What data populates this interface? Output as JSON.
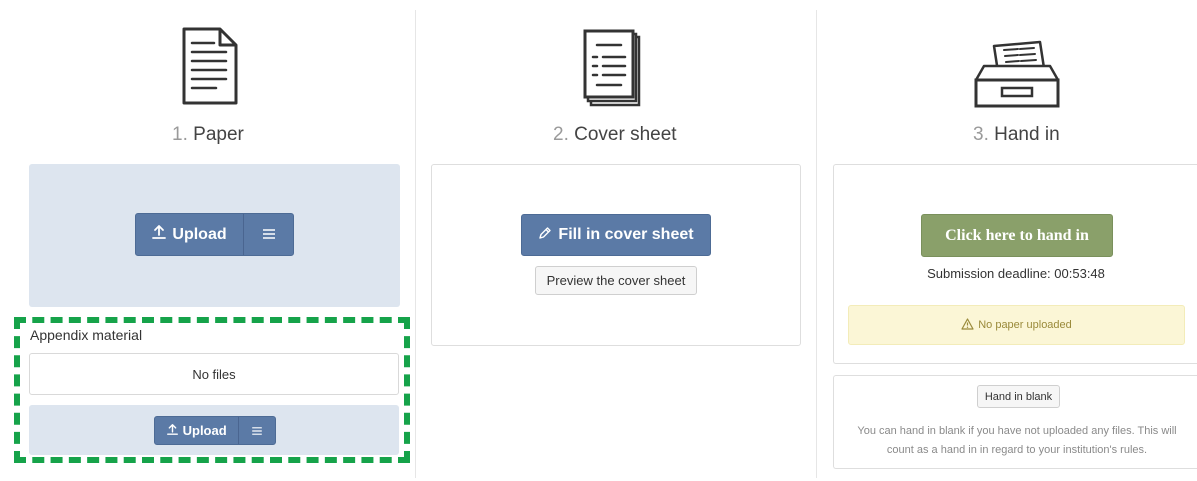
{
  "columns": [
    {
      "number": "1.",
      "title": "Paper",
      "icon": "paper-document-icon"
    },
    {
      "number": "2.",
      "title": "Cover sheet",
      "icon": "cover-sheet-stack-icon"
    },
    {
      "number": "3.",
      "title": "Hand in",
      "icon": "file-drawer-tray-icon"
    }
  ],
  "paper": {
    "upload_label": "Upload",
    "upload_icon": "upload-arrow-icon",
    "menu_icon": "hamburger-menu-icon"
  },
  "appendix": {
    "label": "Appendix material",
    "files_status": "No files",
    "upload_label": "Upload",
    "highlight_color": "#16a34a"
  },
  "cover_sheet": {
    "fill_label": "Fill in cover sheet",
    "fill_icon": "pencil-icon",
    "preview_label": "Preview the cover sheet"
  },
  "hand_in": {
    "button_label": "Click here to hand in",
    "deadline_text": "Submission deadline: 00:53:48",
    "warning_text": "No paper uploaded",
    "warning_icon": "warning-triangle-icon",
    "blank_label": "Hand in blank",
    "blank_help": "You can hand in blank if you have not uploaded any files. This will count as a hand in in regard to your institution's rules."
  },
  "colors": {
    "primary_button": "#5b7aa6",
    "hand_in_button": "#8aa06a",
    "drop_zone": "#dde5ef",
    "warning_bg": "#fbf6d6"
  }
}
